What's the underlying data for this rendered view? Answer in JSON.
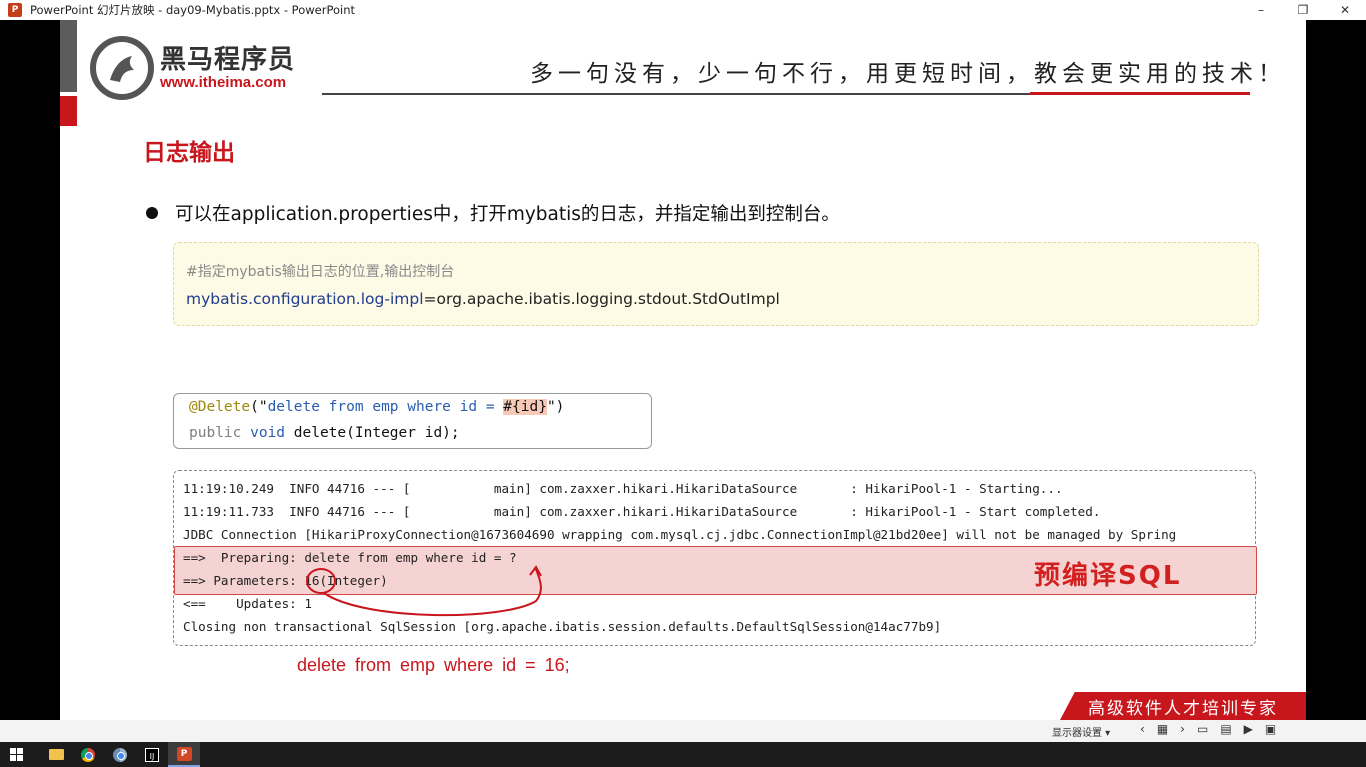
{
  "window": {
    "title": "PowerPoint 幻灯片放映  -  day09-Mybatis.pptx  -  PowerPoint",
    "app_icon_letter": "P",
    "minimize_glyph": "–",
    "maximize_glyph": "❐",
    "close_glyph": "✕"
  },
  "header": {
    "logo_cn": "黑马程序员",
    "logo_url": "www.itheima.com",
    "slogan": "多一句没有，少一句不行，用更短时间，教会更实用的技术！"
  },
  "slide": {
    "heading": "日志输出",
    "bullet": "可以在application.properties中，打开mybatis的日志，并指定输出到控制台。",
    "config": {
      "comment": "#指定mybatis输出日志的位置,输出控制台",
      "key": "mybatis.configuration.log-impl",
      "value": "=org.apache.ibatis.logging.stdout.StdOutImpl"
    },
    "code": {
      "annotation": "@Delete",
      "paren_open": "(\"",
      "sql_text": "delete from emp where id = ",
      "placeholder": "#{id}",
      "paren_close": "\")",
      "line2_public": "public ",
      "line2_void": "void ",
      "line2_rest": "delete(Integer id);"
    },
    "log_lines": [
      "11:19:10.249  INFO 44716 --- [           main] com.zaxxer.hikari.HikariDataSource       : HikariPool-1 - Starting...",
      "11:19:11.733  INFO 44716 --- [           main] com.zaxxer.hikari.HikariDataSource       : HikariPool-1 - Start completed.",
      "JDBC Connection [HikariProxyConnection@1673604690 wrapping com.mysql.cj.jdbc.ConnectionImpl@21bd20ee] will not be managed by Spring",
      "==>  Preparing: delete from emp where id = ?",
      "==> Parameters: 16(Integer)",
      "<==    Updates: 1",
      "Closing non transactional SqlSession [org.apache.ibatis.session.defaults.DefaultSqlSession@14ac77b9]"
    ],
    "precompile_label": "预编译SQL",
    "result_sql": "delete  from  emp  where  id = 16;",
    "banner_text": "高级软件人才培训专家"
  },
  "presentation_bar": {
    "display_settings": "显示器设置 ▾"
  },
  "taskbar": {
    "items": [
      "start",
      "file-explorer",
      "chrome",
      "browser",
      "intellij-idea",
      "powerpoint"
    ]
  },
  "colors": {
    "brand_red": "#c8161d",
    "config_bg": "#fdfae5",
    "log_highlight": "#f6d3d3"
  }
}
